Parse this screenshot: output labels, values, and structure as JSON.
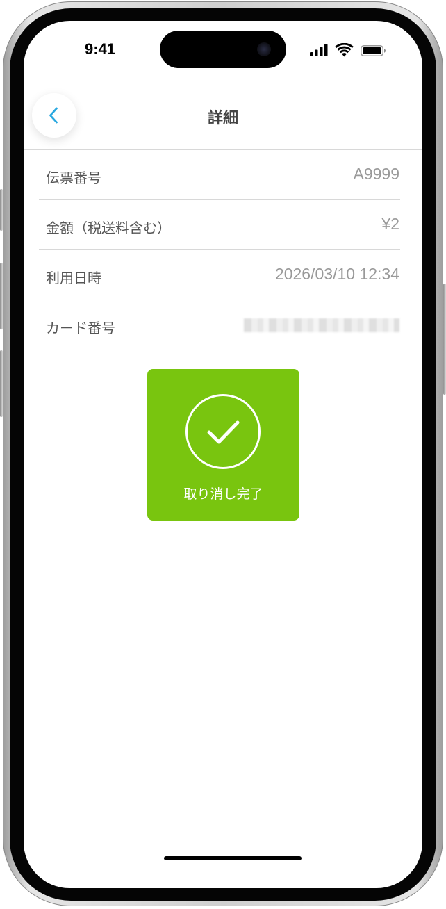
{
  "status_bar": {
    "time": "9:41",
    "signal_icon": "cellular-signal-icon",
    "wifi_icon": "wifi-icon",
    "battery_icon": "battery-icon"
  },
  "nav": {
    "title": "詳細",
    "back_icon": "chevron-left-icon"
  },
  "details": {
    "slip_number": {
      "label": "伝票番号",
      "value": "A9999"
    },
    "amount": {
      "label": "金額（税送料含む）",
      "value": "¥2"
    },
    "usage_datetime": {
      "label": "利用日時",
      "value": "2026/03/10 12:34"
    },
    "card_number": {
      "label": "カード番号",
      "value": ""
    }
  },
  "success": {
    "label": "取り消し完了",
    "icon": "checkmark-circle-icon",
    "color": "#79c50f"
  },
  "colors": {
    "accent": "#29a8e0",
    "success": "#79c50f"
  }
}
